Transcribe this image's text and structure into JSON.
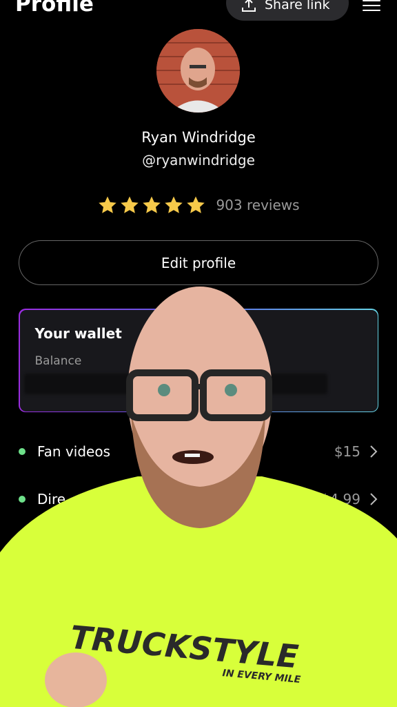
{
  "header": {
    "title": "Profile",
    "share_label": "Share link",
    "share_icon": "upload-icon",
    "menu_icon": "hamburger-menu-icon"
  },
  "profile": {
    "name": "Ryan Windridge",
    "handle": "@ryanwindridge",
    "rating_stars": 5,
    "reviews": "903 reviews"
  },
  "actions": {
    "edit_label": "Edit profile"
  },
  "wallet": {
    "title": "Your wallet",
    "balance_label": "Balance"
  },
  "services": [
    {
      "label": "Fan videos",
      "price": "$15"
    },
    {
      "label": "Dire",
      "price": "$4.99"
    }
  ],
  "overlay": {
    "shirt_text": "TRUCKSTYLE",
    "shirt_subtext": "IN EVERY MILE"
  },
  "colors": {
    "background": "#000000",
    "star": "#f6c94a",
    "status_dot": "#6ee08a",
    "shirt": "#d8ff3a"
  }
}
